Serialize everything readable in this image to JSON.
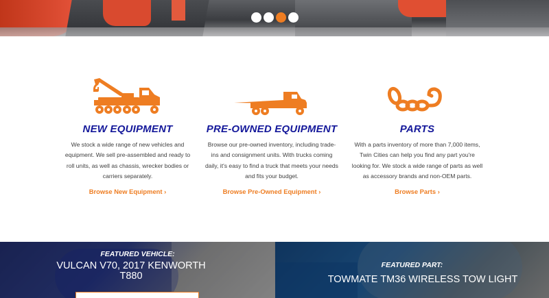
{
  "carousel": {
    "slide_count": 4,
    "active_index": 2
  },
  "columns": [
    {
      "icon": "tow-truck-icon",
      "heading": "NEW EQUIPMENT",
      "body": "We stock a wide range of new vehicles and equipment. We sell pre-assembled and ready to roll units, as well as chassis, wrecker bodies or carriers separately.",
      "link": "Browse New Equipment ›"
    },
    {
      "icon": "flatbed-truck-icon",
      "heading": "PRE-OWNED EQUIPMENT",
      "body": "Browse our pre-owned inventory, including trade-ins and consignment units. With trucks coming daily, it's easy to find a truck that meets your needs and fits your budget.",
      "link": "Browse Pre-Owned Equipment ›"
    },
    {
      "icon": "chain-hook-icon",
      "heading": "PARTS",
      "body": "With a parts inventory of more than 7,000 items, Twin Cities can help you find any part you're looking for. We stock a wide range of parts as well as accessory brands and non-OEM parts.",
      "link": "Browse Parts ›"
    }
  ],
  "featured": {
    "vehicle": {
      "kicker": "FEATURED VEHICLE:",
      "title": "VULCAN V70, 2017 KENWORTH T880"
    },
    "part": {
      "kicker": "FEATURED PART:",
      "title": "TOWMATE TM36 WIRELESS TOW LIGHT"
    }
  },
  "colors": {
    "accent": "#ee7d22",
    "heading": "#14189a",
    "body_text": "#3e3e3e"
  }
}
